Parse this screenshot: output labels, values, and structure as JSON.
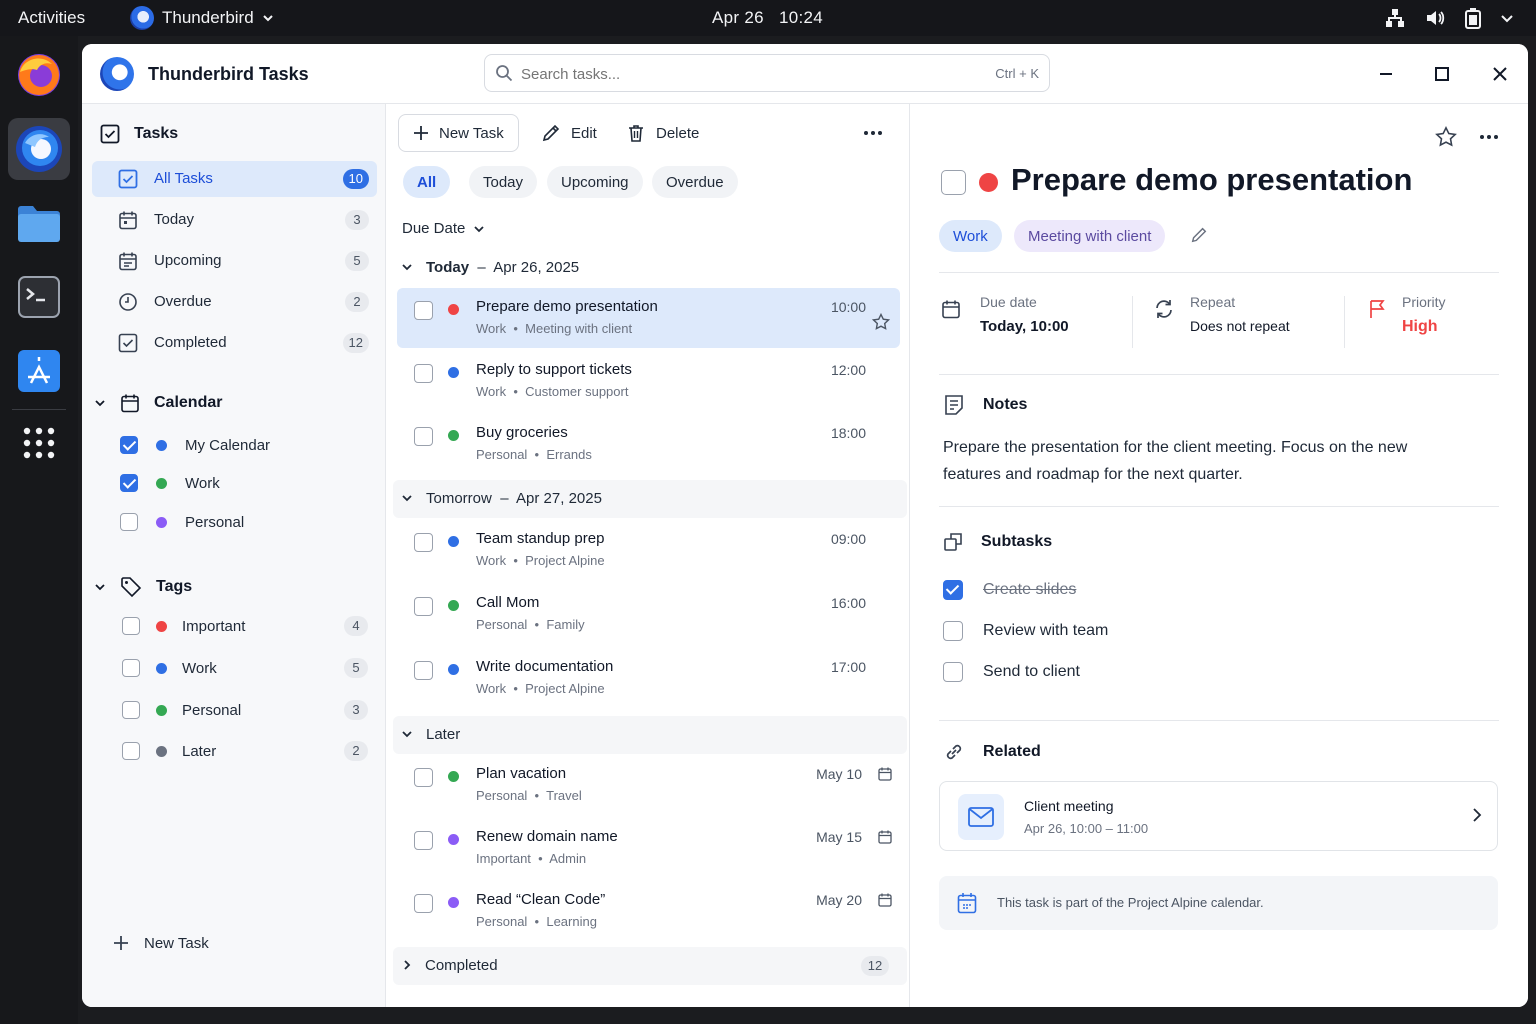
{
  "topbar": {
    "activities": "Activities",
    "app_name": "Thunderbird",
    "date": "Apr 26",
    "time": "10:24"
  },
  "dock": {
    "items": [
      "firefox-icon",
      "thunderbird-icon",
      "files-icon",
      "terminal-icon",
      "app-store-icon",
      "app-grid-icon"
    ]
  },
  "window": {
    "title": "Thunderbird Tasks",
    "search_placeholder": "Search tasks...",
    "search_shortcut": "Ctrl + K"
  },
  "sidebar": {
    "tasks_heading": "Tasks",
    "items": [
      {
        "label": "All Tasks",
        "count": "10"
      },
      {
        "label": "Today",
        "count": "3"
      },
      {
        "label": "Upcoming",
        "count": "5"
      },
      {
        "label": "Overdue",
        "count": "2"
      },
      {
        "label": "Completed",
        "count": "12"
      }
    ],
    "calendar_heading": "Calendar",
    "calendars": [
      {
        "label": "My Calendar",
        "color": "#2f6fe4",
        "checked": true
      },
      {
        "label": "Work",
        "color": "#34a853",
        "checked": true
      },
      {
        "label": "Personal",
        "color": "#8b5cf6",
        "checked": false
      }
    ],
    "tags_heading": "Tags",
    "tags": [
      {
        "label": "Important",
        "color": "#ef4444",
        "count": "4"
      },
      {
        "label": "Work",
        "color": "#2f6fe4",
        "count": "5"
      },
      {
        "label": "Personal",
        "color": "#34a853",
        "count": "3"
      },
      {
        "label": "Later",
        "color": "#6b7280",
        "count": "2"
      }
    ],
    "new_task": "New Task"
  },
  "toolbar": {
    "new_task": "New Task",
    "edit": "Edit",
    "delete": "Delete"
  },
  "filters": [
    "All",
    "Today",
    "Upcoming",
    "Overdue"
  ],
  "sort_label": "Due Date",
  "groups": {
    "today": {
      "name": "Today",
      "date": "Apr 26, 2025"
    },
    "tomorrow": {
      "name": "Tomorrow",
      "date": "Apr 27, 2025"
    },
    "later": {
      "name": "Later"
    },
    "completed": {
      "name": "Completed",
      "count": "12"
    }
  },
  "tasks": [
    {
      "title": "Prepare demo presentation",
      "calendar": "Work",
      "context": "Meeting with client",
      "time": "10:00",
      "color": "#ef4444"
    },
    {
      "title": "Reply to support tickets",
      "calendar": "Work",
      "context": "Customer support",
      "time": "12:00",
      "color": "#2f6fe4"
    },
    {
      "title": "Buy groceries",
      "calendar": "Personal",
      "context": "Errands",
      "time": "18:00",
      "color": "#34a853"
    },
    {
      "title": "Team standup prep",
      "calendar": "Work",
      "context": "Project Alpine",
      "time": "09:00",
      "color": "#2f6fe4"
    },
    {
      "title": "Call Mom",
      "calendar": "Personal",
      "context": "Family",
      "time": "16:00",
      "color": "#34a853"
    },
    {
      "title": "Write documentation",
      "calendar": "Work",
      "context": "Project Alpine",
      "time": "17:00",
      "color": "#2f6fe4"
    },
    {
      "title": "Plan vacation",
      "calendar": "Personal",
      "context": "Travel",
      "time": "May 10",
      "color": "#34a853"
    },
    {
      "title": "Renew domain name",
      "calendar": "Important",
      "context": "Admin",
      "time": "May 15",
      "color": "#8b5cf6"
    },
    {
      "title": "Read “Clean Code”",
      "calendar": "Personal",
      "context": "Learning",
      "time": "May 20",
      "color": "#8b5cf6"
    }
  ],
  "meta_separator": "•",
  "detail": {
    "title": "Prepare demo presentation",
    "priority_color": "#ef4444",
    "tags": [
      "Work",
      "Meeting with client"
    ],
    "due_label": "Due date",
    "due_value": "Today, 10:00",
    "repeat_label": "Repeat",
    "repeat_value": "Does not repeat",
    "priority_label": "Priority",
    "priority_value": "High",
    "notes_heading": "Notes",
    "notes": "Prepare the presentation for the client meeting. Focus on the new features and roadmap for the next quarter.",
    "subtasks_heading": "Subtasks",
    "subtasks": [
      {
        "label": "Create slides",
        "done": true
      },
      {
        "label": "Review with team",
        "done": false
      },
      {
        "label": "Send to client",
        "done": false
      }
    ],
    "related_heading": "Related",
    "related_title": "Client meeting",
    "related_time": "Apr 26, 10:00 – 11:00",
    "info_text": "This task is part of the Project Alpine calendar."
  }
}
